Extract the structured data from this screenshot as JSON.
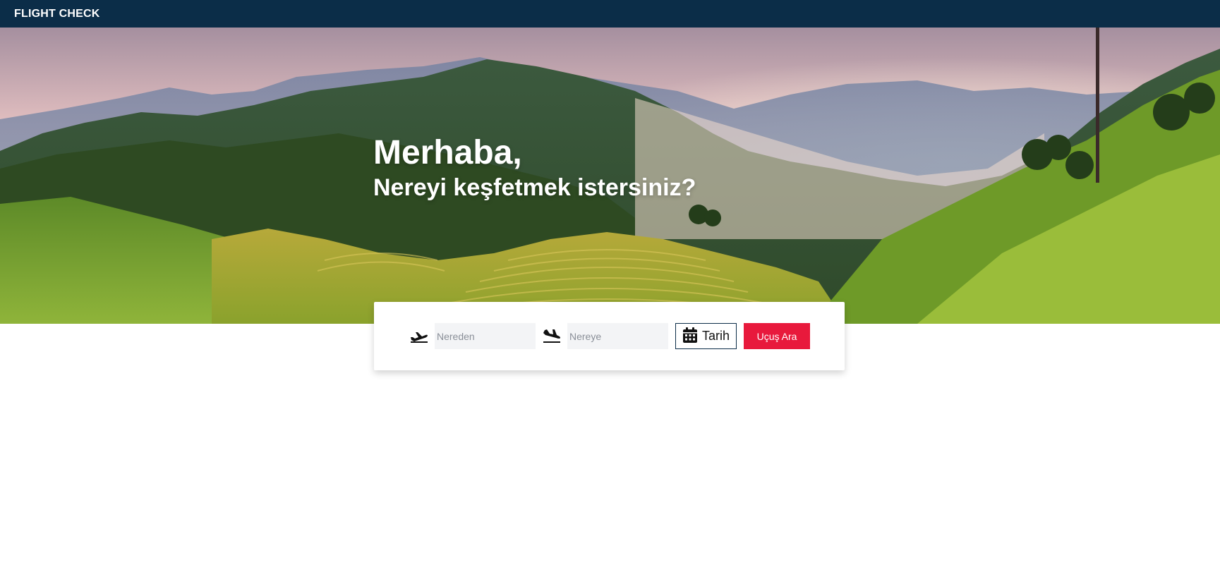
{
  "navbar": {
    "brand": "FLIGHT CHECK"
  },
  "hero": {
    "title": "Merhaba,",
    "subtitle": "Nereyi keşfetmek istersiniz?"
  },
  "search": {
    "from_placeholder": "Nereden",
    "to_placeholder": "Nereye",
    "date_label": "Tarih",
    "submit_label": "Uçuş Ara",
    "icons": {
      "from": "plane-departure-icon",
      "to": "plane-arrival-icon",
      "date": "calendar-icon"
    }
  },
  "colors": {
    "navbar_bg": "#0b2d48",
    "accent": "#e8193c",
    "input_bg": "#f3f4f6"
  }
}
